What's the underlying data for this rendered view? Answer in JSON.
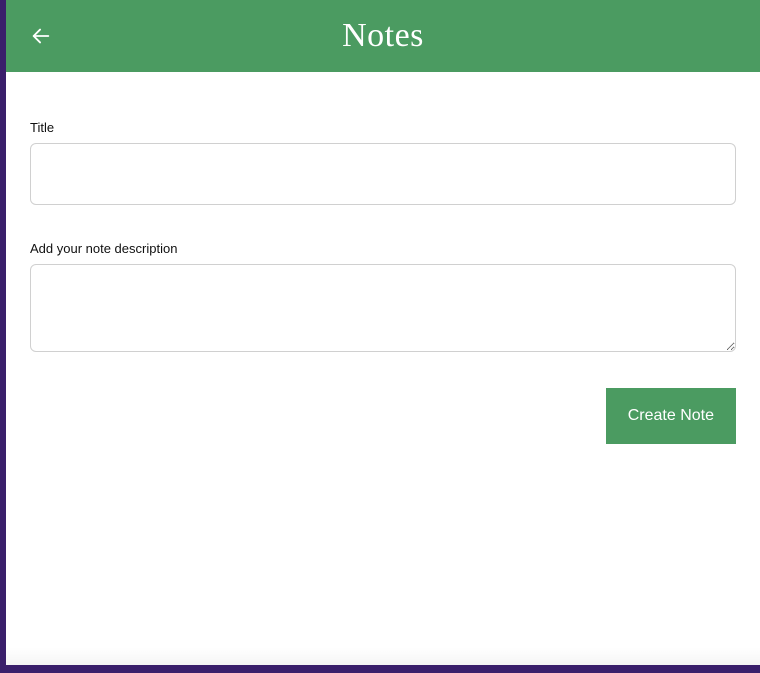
{
  "header": {
    "title": "Notes"
  },
  "form": {
    "title_label": "Title",
    "title_value": "",
    "description_label": "Add your note description",
    "description_value": ""
  },
  "actions": {
    "create_label": "Create Note"
  },
  "colors": {
    "accent": "#4b9b61",
    "backdrop": "#3a1f6b"
  }
}
